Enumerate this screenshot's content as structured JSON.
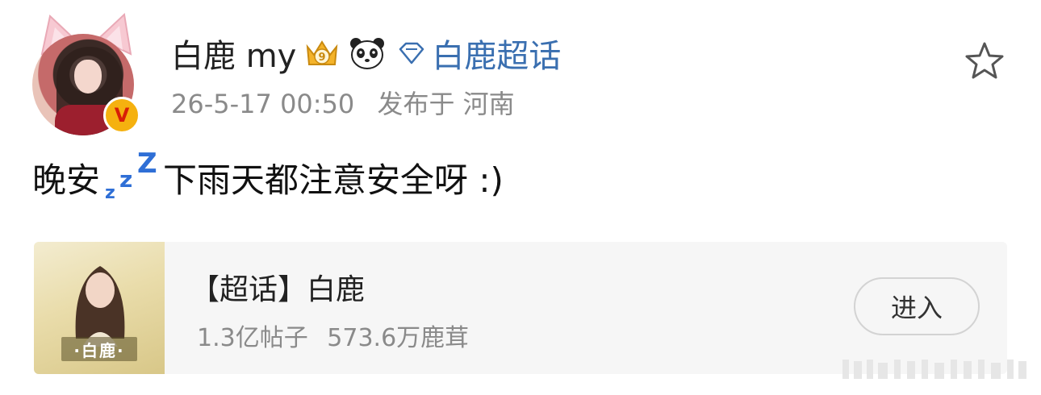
{
  "post": {
    "username": "白鹿 my",
    "supertopic_link": "白鹿超话",
    "timestamp": "26-5-17 00:50",
    "location": "发布于 河南",
    "content_before": "晚安",
    "content_after": "下雨天都注意安全呀 :)"
  },
  "icons": {
    "verified": "verified-v-badge",
    "crown": "crown-level-badge",
    "panda": "panda-badge",
    "diamond": "diamond-icon",
    "sleep": "zzz-emoji",
    "favorite": "star-outline-icon"
  },
  "verified_badge_text": "V",
  "level_badge_text": "9",
  "card": {
    "title": "【超话】白鹿",
    "posts": "1.3亿帖子",
    "followers": "573.6万鹿茸",
    "cover_label": "·白鹿·",
    "button_label": "进入"
  },
  "colors": {
    "link_blue": "#3a6fb0",
    "meta_gray": "#8a8a8a",
    "badge_gold": "#f5b10f"
  }
}
